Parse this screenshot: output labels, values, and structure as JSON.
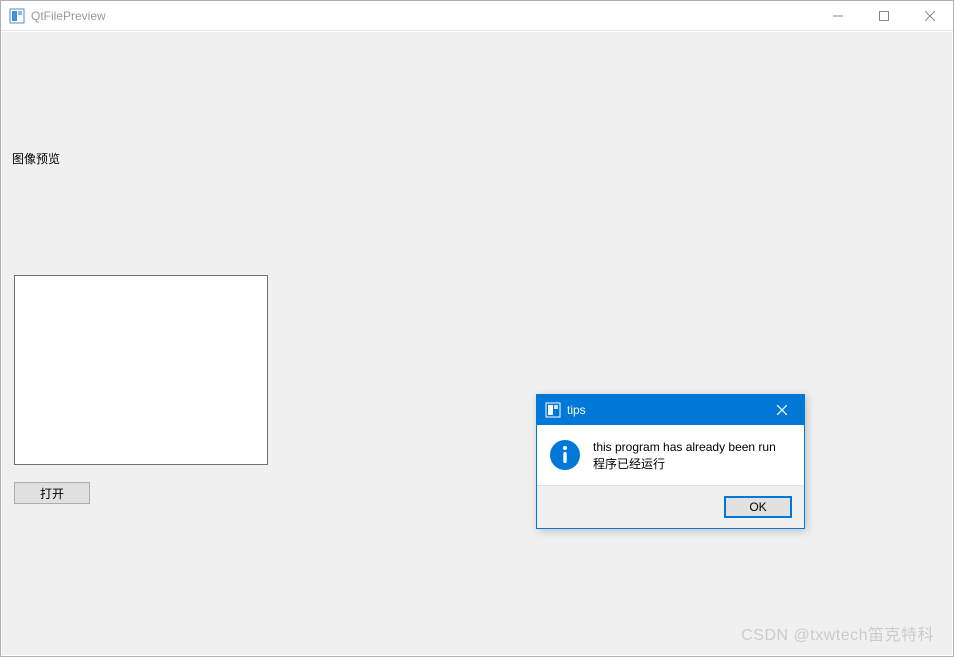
{
  "main_window": {
    "title": "QtFilePreview",
    "label_preview": "图像预览",
    "open_button": "打开"
  },
  "dialog": {
    "title": "tips",
    "message_line1": "this program has already been run",
    "message_line2": "程序已经运行",
    "ok_button": "OK"
  },
  "watermark": "CSDN @txwtech笛克特科"
}
